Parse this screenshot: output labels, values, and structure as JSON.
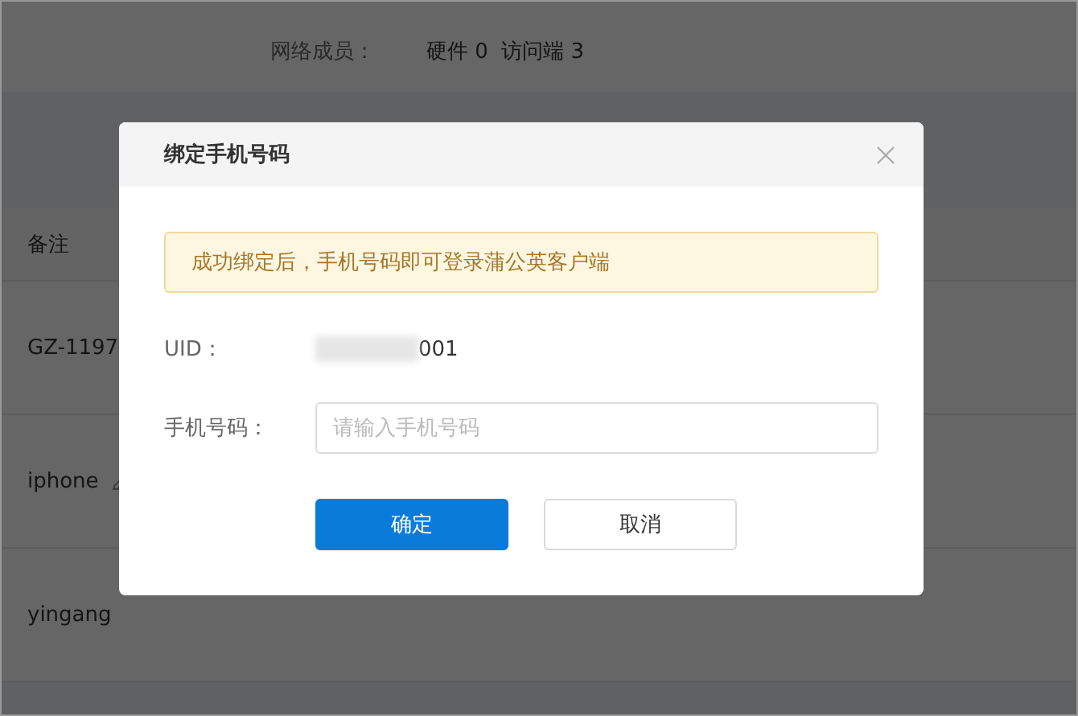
{
  "info": {
    "label": "网络成员：",
    "value": "硬件 0  访问端 3"
  },
  "table": {
    "columns": [
      "备注"
    ],
    "rows": [
      {
        "note": "GZ-1197",
        "edit": false
      },
      {
        "note": "iphone",
        "edit": true
      },
      {
        "note": "yingang",
        "edit": false
      }
    ]
  },
  "dialog": {
    "title": "绑定手机号码",
    "notice": "成功绑定后，手机号码即可登录蒲公英客户端",
    "uid": {
      "label": "UID：",
      "value": "001",
      "masked": true
    },
    "phone": {
      "label": "手机号码：",
      "placeholder": "请输入手机号码"
    },
    "buttons": [
      {
        "label": "确定",
        "kind": "primary"
      },
      {
        "label": "取消",
        "kind": "secondary"
      }
    ]
  }
}
